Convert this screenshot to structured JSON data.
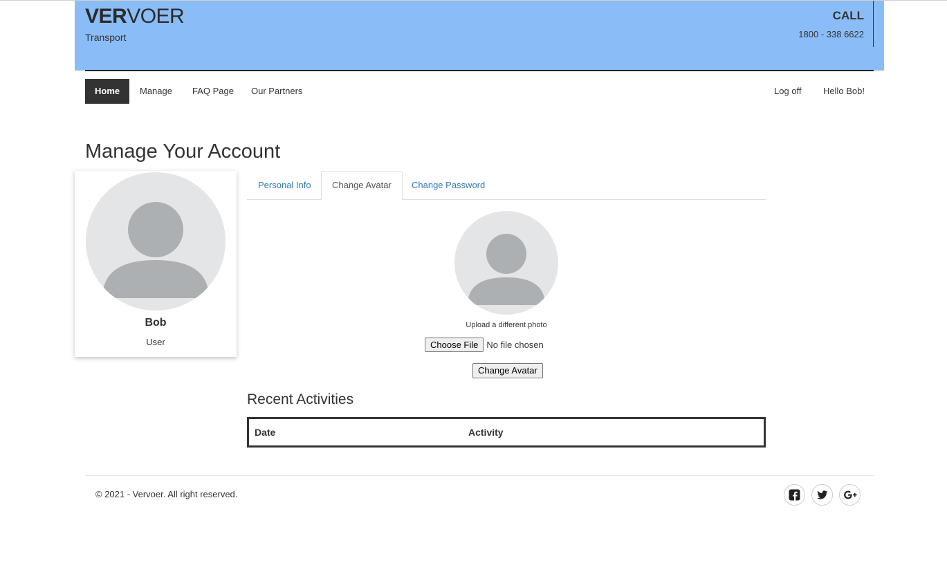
{
  "header": {
    "brand_bold": "VER",
    "brand_light": "VOER",
    "brand_sub": "Transport",
    "call_label": "CALL",
    "call_phone": "1800 - 338 6622"
  },
  "nav": {
    "home": "Home",
    "manage": "Manage",
    "faq": "FAQ Page",
    "partners": "Our Partners",
    "logoff": "Log off",
    "greeting": "Hello Bob!"
  },
  "page": {
    "title": "Manage Your Account"
  },
  "profile": {
    "name": "Bob",
    "role": "User"
  },
  "tabs": [
    {
      "label": "Personal Info"
    },
    {
      "label": "Change Avatar"
    },
    {
      "label": "Change Password"
    }
  ],
  "avatar_form": {
    "upload_label": "Upload a different photo",
    "choose_file": "Choose File",
    "file_status": "No file chosen",
    "submit": "Change Avatar"
  },
  "activities": {
    "title": "Recent Activities",
    "columns": [
      "Date",
      "Activity"
    ]
  },
  "footer": {
    "copyright": "© 2021 - Vervoer. All right reserved."
  },
  "colors": {
    "header_bg": "#8abdf7",
    "nav_active_bg": "#333333",
    "link": "#337ab7",
    "avatar_bg": "#e4e5e7",
    "avatar_fg": "#adb0b3"
  },
  "icons": [
    "facebook-icon",
    "twitter-icon",
    "google-plus-icon"
  ]
}
